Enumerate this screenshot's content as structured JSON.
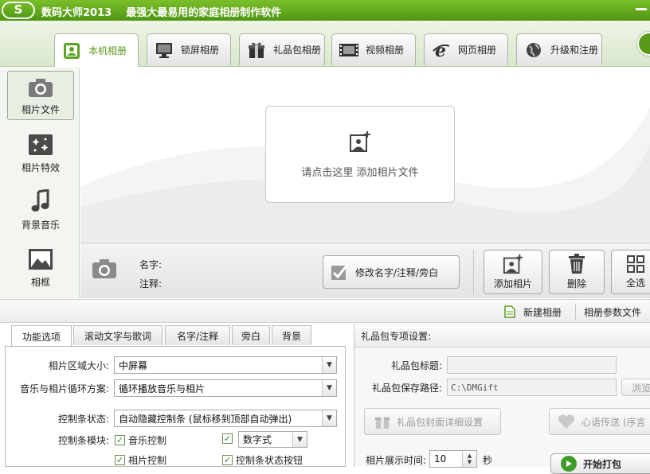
{
  "app": {
    "logo_text": "S",
    "title": "数码大师2013",
    "subtitle": "最强大最易用的家庭相册制作软件"
  },
  "nav_tabs": [
    {
      "label": "本机相册",
      "icon": "photo-album-icon",
      "active": true
    },
    {
      "label": "锁屏相册",
      "icon": "monitor-icon",
      "active": false
    },
    {
      "label": "礼品包相册",
      "icon": "gift-icon",
      "active": false
    },
    {
      "label": "视频相册",
      "icon": "film-icon",
      "active": false
    },
    {
      "label": "网页相册",
      "icon": "ie-icon",
      "active": false
    },
    {
      "label": "升级和注册",
      "icon": "globe-icon",
      "active": false
    }
  ],
  "side_nav": [
    {
      "label": "相片文件",
      "icon": "camera-icon",
      "active": true
    },
    {
      "label": "相片特效",
      "icon": "sparkle-effect-icon",
      "active": false
    },
    {
      "label": "背景音乐",
      "icon": "music-note-icon",
      "active": false
    },
    {
      "label": "相框",
      "icon": "picture-frame-icon",
      "active": false
    }
  ],
  "photo_area": {
    "add_hint": "请点击这里 添加相片文件"
  },
  "info": {
    "name_label": "名字:",
    "note_label": "注释:",
    "edit_button": "修改名字/注释/旁白"
  },
  "photo_actions": {
    "add": "添加相片",
    "delete": "删除",
    "select_all": "全选"
  },
  "album_bar": {
    "new_album": "新建相册",
    "album_params": "相册参数文件"
  },
  "settings_tabs": [
    {
      "label": "功能选项",
      "active": true
    },
    {
      "label": "滚动文字与歌词",
      "active": false
    },
    {
      "label": "名字/注释",
      "active": false
    },
    {
      "label": "旁白",
      "active": false
    },
    {
      "label": "背景",
      "active": false
    }
  ],
  "options": {
    "photo_size_label": "相片区域大小:",
    "photo_size_value": "中屏幕",
    "loop_label": "音乐与相片循环方案:",
    "loop_value": "循环播放音乐与相片",
    "control_bar_label": "控制条状态:",
    "control_bar_value": "自动隐藏控制条 (鼠标移到顶部自动弹出)",
    "control_module_label": "控制条模块:",
    "music_control": "音乐控制",
    "digital_style_value": "数字式",
    "photo_control": "相片控制",
    "control_bar_state_button": "控制条状态按钮"
  },
  "gift": {
    "header": "礼品包专项设置:",
    "title_label": "礼品包标题:",
    "title_value": "",
    "save_path_label": "礼品包保存路径:",
    "save_path_value": "C:\\DMGift",
    "browse_button": "浏览",
    "cover_button": "礼品包封面详细设置",
    "heart_button": "心语传送 (序言",
    "display_time_label": "相片展示时间:",
    "display_time_value": "10",
    "display_time_unit": "秒",
    "start_button": "开始打包"
  },
  "colors": {
    "brand_green": "#5a9a1a",
    "title_bar": "#6aad22"
  }
}
